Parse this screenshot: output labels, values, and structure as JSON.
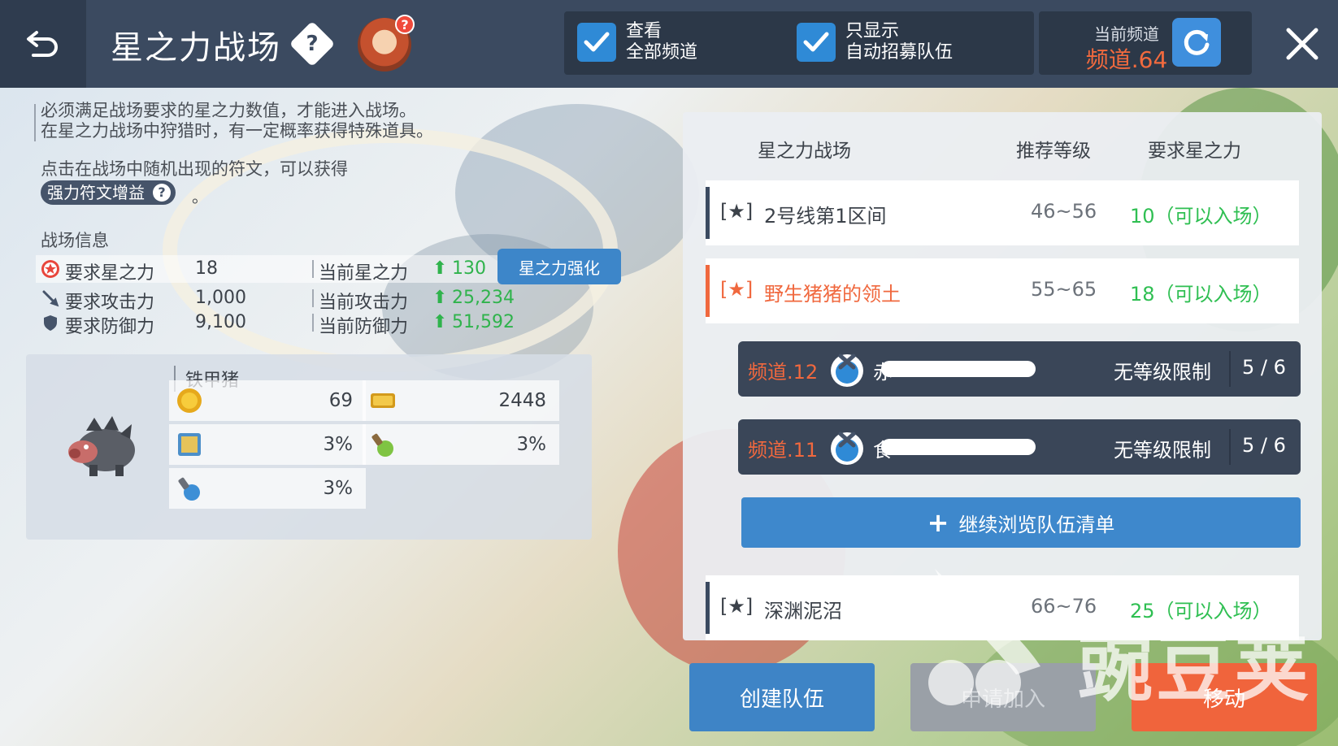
{
  "header": {
    "title": "星之力战场",
    "filter_all_channels": {
      "line1": "查看",
      "line2": "全部频道",
      "checked": true
    },
    "filter_auto_recruit": {
      "line1": "只显示",
      "line2": "自动招募队伍",
      "checked": true
    },
    "current_channel_caption": "当前频道",
    "current_channel_value": "频道.64"
  },
  "info": {
    "desc_line1": "必须满足战场要求的星之力数值，才能进入战场。",
    "desc_line2": "在星之力战场中狩猎时，有一定概率获得特殊道具。",
    "desc_line3": "点击在战场中随机出现的符文，可以获得",
    "rune_chip": "强力符文增益",
    "rune_suffix": "。",
    "section_title": "战场信息",
    "stats": [
      {
        "label": "要求星之力",
        "value": "18",
        "current_label": "当前星之力",
        "current_value": "130"
      },
      {
        "label": "要求攻击力",
        "value": "1,000",
        "current_label": "当前攻击力",
        "current_value": "25,234"
      },
      {
        "label": "要求防御力",
        "value": "9,100",
        "current_label": "当前防御力",
        "current_value": "51,592"
      }
    ],
    "boost_button": "星之力强化"
  },
  "monster": {
    "name": "铁甲猪",
    "drops": [
      {
        "icon": "gold-coin-icon",
        "value": "69"
      },
      {
        "icon": "exp-icon",
        "value": "2448"
      },
      {
        "icon": "card-icon",
        "value": "3%"
      },
      {
        "icon": "potion-icon",
        "value": "3%"
      },
      {
        "icon": "scroll-icon",
        "value": "3%"
      }
    ]
  },
  "battlefields": {
    "headers": {
      "name": "星之力战场",
      "level": "推荐等级",
      "req": "要求星之力"
    },
    "rows": [
      {
        "star": "[★]",
        "name": "2号线第1区间",
        "level": "46~56",
        "req": "10（可以入场）",
        "selected": false
      },
      {
        "star": "[★]",
        "name": "野生猪猪的领土",
        "level": "55~65",
        "req": "18（可以入场）",
        "selected": true
      },
      {
        "star": "[★]",
        "name": "深渊泥沼",
        "level": "66~76",
        "req": "25（可以入场）",
        "selected": false
      }
    ],
    "teams": [
      {
        "channel": "频道.12",
        "name": "赤",
        "limit": "无等级限制",
        "count": "5 / 6"
      },
      {
        "channel": "频道.11",
        "name": "食",
        "limit": "无等级限制",
        "count": "5 / 6"
      }
    ],
    "browse_button": "继续浏览队伍清单"
  },
  "actions": {
    "create": "创建队伍",
    "join": "申请加入",
    "move": "移动"
  },
  "watermark": "豌豆荚",
  "colors": {
    "topbar": "#3b4a60",
    "accent_blue": "#3e88cc",
    "accent_orange": "#f0683e",
    "ok_green": "#2fbf52"
  }
}
